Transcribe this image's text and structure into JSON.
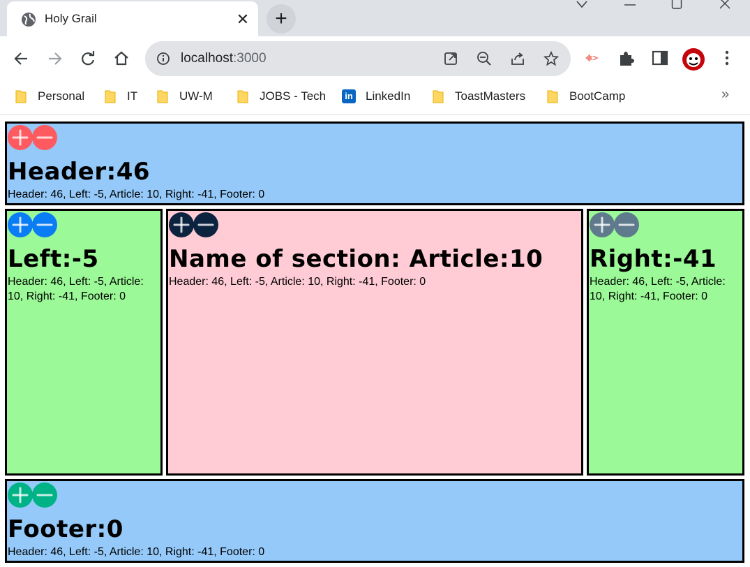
{
  "browser": {
    "tab_title": "Holy Grail",
    "url_host": "localhost",
    "url_port": ":3000",
    "bookmarks": [
      {
        "label": "Personal",
        "icon": "folder-icon"
      },
      {
        "label": "IT",
        "icon": "folder-icon"
      },
      {
        "label": "UW-M",
        "icon": "folder-icon"
      },
      {
        "label": "JOBS - Tech",
        "icon": "folder-icon"
      },
      {
        "label": "LinkedIn",
        "icon": "linkedin-icon"
      },
      {
        "label": "ToastMasters",
        "icon": "folder-icon"
      },
      {
        "label": "BootCamp",
        "icon": "folder-icon"
      }
    ],
    "more_bookmarks": "»"
  },
  "sections": {
    "header": {
      "title": "Header:46",
      "summary": "Header: 46, Left: -5, Article: 10, Right: -41, Footer: 0",
      "button_color": "#ff5a5f"
    },
    "left": {
      "title": "Left:-5",
      "summary": "Header: 46, Left: -5, Article: 10, Right: -41, Footer: 0",
      "button_color": "#0a7cf5"
    },
    "article": {
      "title": "Name of section: Article:10",
      "summary": "Header: 46, Left: -5, Article: 10, Right: -41, Footer: 0",
      "button_color": "#0c2340"
    },
    "right": {
      "title": "Right:-41",
      "summary": "Header: 46, Left: -5, Article: 10, Right: -41, Footer: 0",
      "button_color": "#5f7a8c"
    },
    "footer": {
      "title": "Footer:0",
      "summary": "Header: 46, Left: -5, Article: 10, Right: -41, Footer: 0",
      "button_color": "#00b386"
    }
  },
  "colors": {
    "header_footer_bg": "#94c9f9",
    "side_bg": "#9bfa97",
    "article_bg": "#ffcbd5"
  }
}
